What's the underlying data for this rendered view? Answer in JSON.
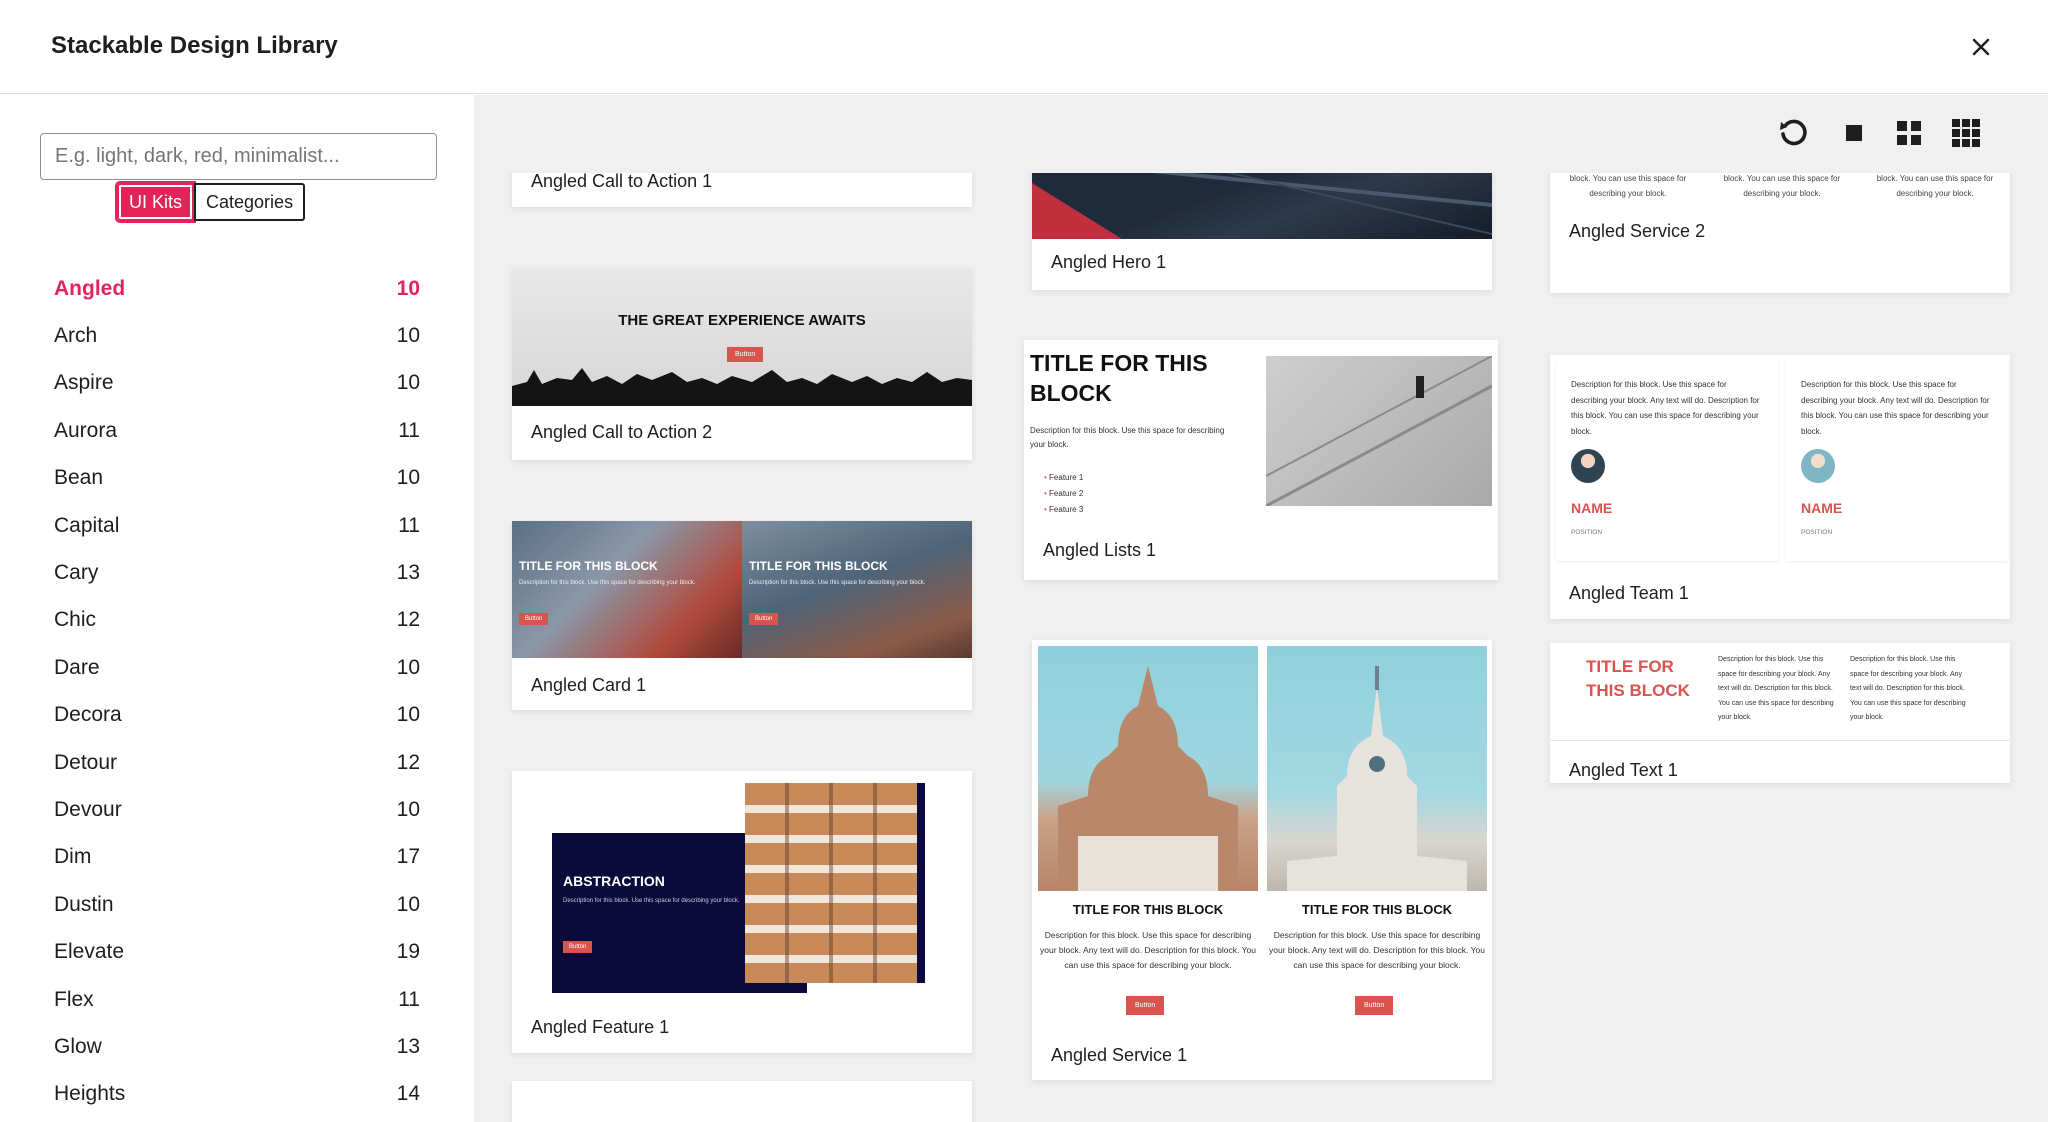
{
  "header": {
    "title": "Stackable Design Library"
  },
  "sidebar": {
    "search_placeholder": "E.g. light, dark, red, minimalist...",
    "toggle": {
      "ui_kits": "UI Kits",
      "categories": "Categories"
    },
    "kits": [
      {
        "name": "Angled",
        "count": "10"
      },
      {
        "name": "Arch",
        "count": "10"
      },
      {
        "name": "Aspire",
        "count": "10"
      },
      {
        "name": "Aurora",
        "count": "11"
      },
      {
        "name": "Bean",
        "count": "10"
      },
      {
        "name": "Capital",
        "count": "11"
      },
      {
        "name": "Cary",
        "count": "13"
      },
      {
        "name": "Chic",
        "count": "12"
      },
      {
        "name": "Dare",
        "count": "10"
      },
      {
        "name": "Decora",
        "count": "10"
      },
      {
        "name": "Detour",
        "count": "12"
      },
      {
        "name": "Devour",
        "count": "10"
      },
      {
        "name": "Dim",
        "count": "17"
      },
      {
        "name": "Dustin",
        "count": "10"
      },
      {
        "name": "Elevate",
        "count": "19"
      },
      {
        "name": "Flex",
        "count": "11"
      },
      {
        "name": "Glow",
        "count": "13"
      },
      {
        "name": "Heights",
        "count": "14"
      }
    ]
  },
  "cards": {
    "cta1": "Angled Call to Action 1",
    "cta2": "Angled Call to Action 2",
    "card1": "Angled Card 1",
    "feature1": "Angled Feature 1",
    "hero1": "Angled Hero 1",
    "lists1": "Angled Lists 1",
    "service1": "Angled Service 1",
    "service2": "Angled Service 2",
    "team1": "Angled Team 1",
    "text1": "Angled Text 1"
  },
  "previews": {
    "cta2_title": "THE GREAT EXPERIENCE AWAITS",
    "button": "Button",
    "card_title": "TITLE FOR THIS BLOCK",
    "desc_short": "Description for this block. Use this space for describing your block.",
    "desc_long": "Description for this block. Use this space for describing your block. Any text will do. Description for this block. You can use this space for describing your block.",
    "service2_desc": "block. You can use this space for describing your block.",
    "feature_title": "ABSTRACTION",
    "lists_title": "TITLE FOR THIS BLOCK",
    "lists_desc": "Description for this block. Use this space for describing your block.",
    "features": [
      "Feature 1",
      "Feature 2",
      "Feature 3"
    ],
    "team_name": "NAME",
    "team_position": "POSITION",
    "text_title": "TITLE FOR THIS BLOCK",
    "text_desc": "Description for this block. Use this space for describing your block. Any text will do. Description for this block. You can use this space for describing your block."
  },
  "colors": {
    "accent": "#e3245a",
    "preview_button": "#d9534f",
    "navy": "#0b0a3a"
  }
}
